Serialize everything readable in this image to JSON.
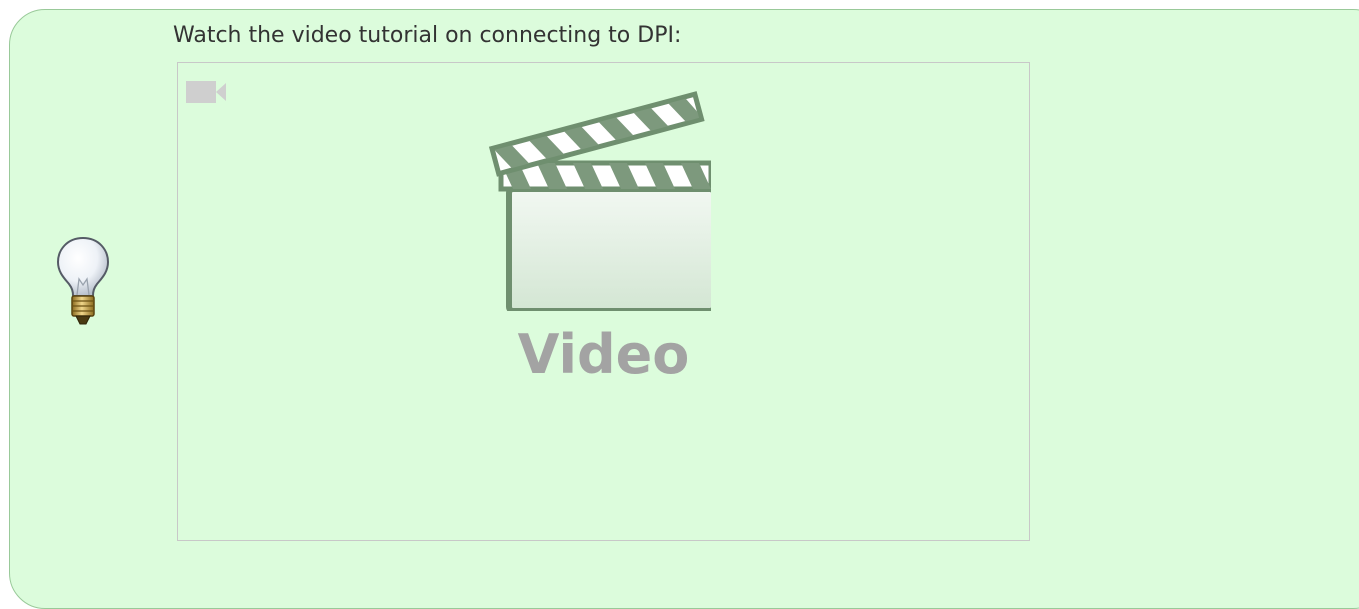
{
  "tip": {
    "text": "Watch the video tutorial on connecting to DPI:",
    "icon": "lightbulb-icon"
  },
  "video": {
    "label": "Video",
    "corner_icon": "video-camera-icon",
    "placeholder_icon": "clapperboard-icon"
  },
  "colors": {
    "tip_background": "#dcfcdc",
    "tip_border": "#99c999",
    "video_border": "#c8c8c8",
    "video_label": "#a3a3a3"
  }
}
